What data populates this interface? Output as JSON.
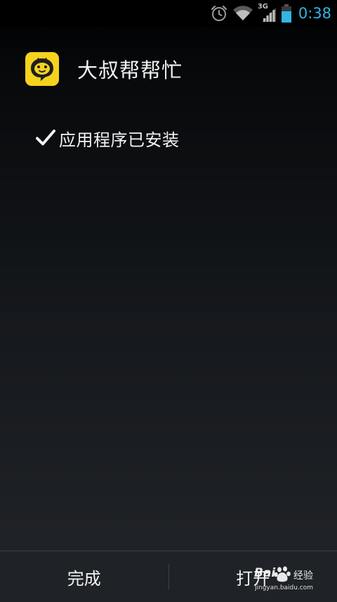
{
  "status_bar": {
    "time": "0:38",
    "network_label": "3G",
    "time_color": "#33b5e5",
    "icons": [
      "alarm-icon",
      "wifi-icon",
      "signal-icon",
      "battery-icon"
    ]
  },
  "app": {
    "name": "大叔帮帮忙",
    "icon": "chat-bubble-face-icon",
    "icon_color": "#f5d21e"
  },
  "install": {
    "message": "应用程序已安装",
    "icon": "checkmark-icon"
  },
  "actions": {
    "done_label": "完成",
    "open_label": "打开"
  },
  "watermark": {
    "brand": "Bai",
    "brand_suffix": "经验",
    "url": "jingyan.baidu.com"
  }
}
